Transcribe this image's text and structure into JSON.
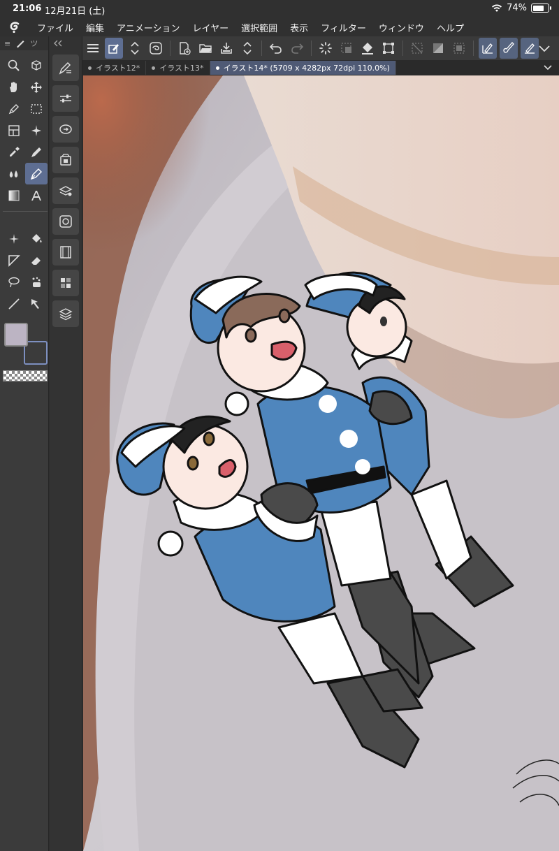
{
  "status": {
    "time": "21:06",
    "date": "12月21日 (土)",
    "battery": "74%",
    "battery_level": 0.74
  },
  "menu": {
    "logo_icon": "clip-studio-logo-icon",
    "items": [
      "ファイル",
      "編集",
      "アニメーション",
      "レイヤー",
      "選択範囲",
      "表示",
      "フィルター",
      "ウィンドウ",
      "ヘルプ"
    ]
  },
  "toolbar": {
    "icons": [
      "menu-icon",
      "edit-layer-icon",
      "up-down-icon",
      "lasso-fill-icon",
      "new-canvas-icon",
      "open-folder-icon",
      "save-icon",
      "up-down-icon",
      "undo-icon",
      "redo-icon",
      "loading-icon",
      "deselect-icon",
      "fill-icon",
      "transform-icon",
      "clear-icon",
      "clear-outside-icon",
      "select-all-icon",
      "pen-stabilize-icon",
      "brush-icon",
      "eraser-pen-icon",
      "chevron-down-icon"
    ]
  },
  "tabs": [
    {
      "label": "イラスト12*",
      "active": false
    },
    {
      "label": "イラスト13*",
      "active": false
    },
    {
      "label": "イラスト14* (5709 x 4282px 72dpi 110.0%)",
      "active": true
    }
  ],
  "tool_palette": {
    "header_glyph": "≡",
    "header_tab": "ツ",
    "tools": [
      "zoom-icon",
      "3d-object-icon",
      "hand-icon",
      "move-icon",
      "pen-icon",
      "rectangle-select-icon",
      "frame-icon",
      "magic-wand-icon",
      "eyedropper-icon",
      "pencil-icon",
      "blend-icon",
      "pen-tool-icon",
      "gradient-icon",
      "text-icon",
      "sparkle-icon",
      "fill-bucket-icon",
      "ruler-icon",
      "eraser-icon",
      "lasso-icon",
      "decoration-icon",
      "line-icon",
      "operation-icon"
    ],
    "selected_tool": "pen-tool-icon",
    "main_color": "#bcb4c3",
    "sub_color_border": "#7d8fc0"
  },
  "side_panel": {
    "buttons": [
      "sub-tool-icon",
      "tool-property-icon",
      "brush-size-icon",
      "material-icon",
      "layer-property-icon",
      "navigator-icon",
      "timeline-icon",
      "color-set-icon",
      "layer-icon"
    ]
  },
  "colors": {
    "accent": "#5e6e92",
    "santa_blue": "#4f86bd",
    "boot_gray": "#4a4a4a"
  }
}
